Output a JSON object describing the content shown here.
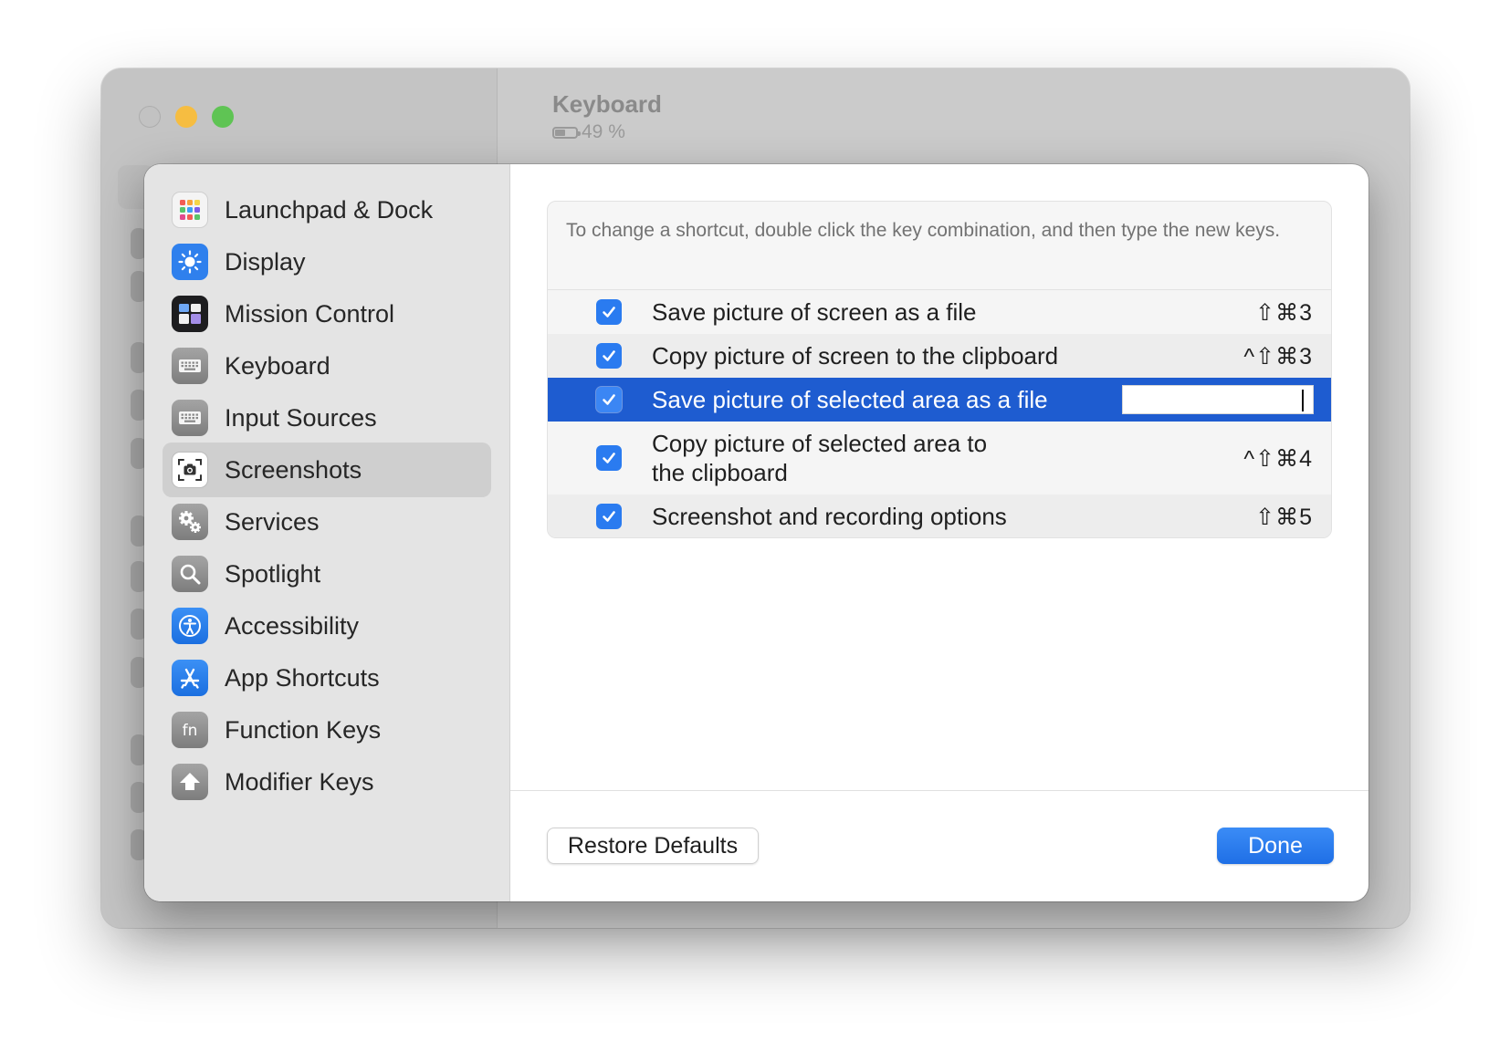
{
  "window": {
    "title": "Keyboard",
    "battery_text": "49 %",
    "battery_level": 0.49
  },
  "sidebar": {
    "items": [
      {
        "label": "Launchpad & Dock",
        "icon": "launchpad-icon"
      },
      {
        "label": "Display",
        "icon": "display-brightness-icon"
      },
      {
        "label": "Mission Control",
        "icon": "mission-control-icon"
      },
      {
        "label": "Keyboard",
        "icon": "keyboard-icon"
      },
      {
        "label": "Input Sources",
        "icon": "input-sources-icon"
      },
      {
        "label": "Screenshots",
        "icon": "screenshot-camera-icon",
        "selected": true
      },
      {
        "label": "Services",
        "icon": "services-gears-icon"
      },
      {
        "label": "Spotlight",
        "icon": "spotlight-magnifier-icon"
      },
      {
        "label": "Accessibility",
        "icon": "accessibility-icon"
      },
      {
        "label": "App Shortcuts",
        "icon": "app-store-icon"
      },
      {
        "label": "Function Keys",
        "icon": "fn-key-icon"
      },
      {
        "label": "Modifier Keys",
        "icon": "modifier-up-arrow-icon"
      }
    ]
  },
  "content": {
    "instructions": "To change a shortcut, double click the key combination, and then type the new keys.",
    "shortcuts": [
      {
        "label": "Save picture of screen as a file",
        "keys": "⇧⌘3",
        "checked": true
      },
      {
        "label": "Copy picture of screen to the clipboard",
        "keys": "^⇧⌘3",
        "checked": true
      },
      {
        "label": "Save picture of selected area as a file",
        "keys": "",
        "checked": true,
        "editing": true
      },
      {
        "label": "Copy picture of selected area to\nthe clipboard",
        "keys": "^⇧⌘4",
        "checked": true
      },
      {
        "label": "Screenshot and recording options",
        "keys": "⇧⌘5",
        "checked": true
      }
    ]
  },
  "footer": {
    "restore_label": "Restore Defaults",
    "done_label": "Done"
  },
  "colors": {
    "accent": "#2a7bf0",
    "selection": "#1e5cd0",
    "traffic_minimize": "#f6bd41",
    "traffic_maximize": "#5fc454"
  }
}
